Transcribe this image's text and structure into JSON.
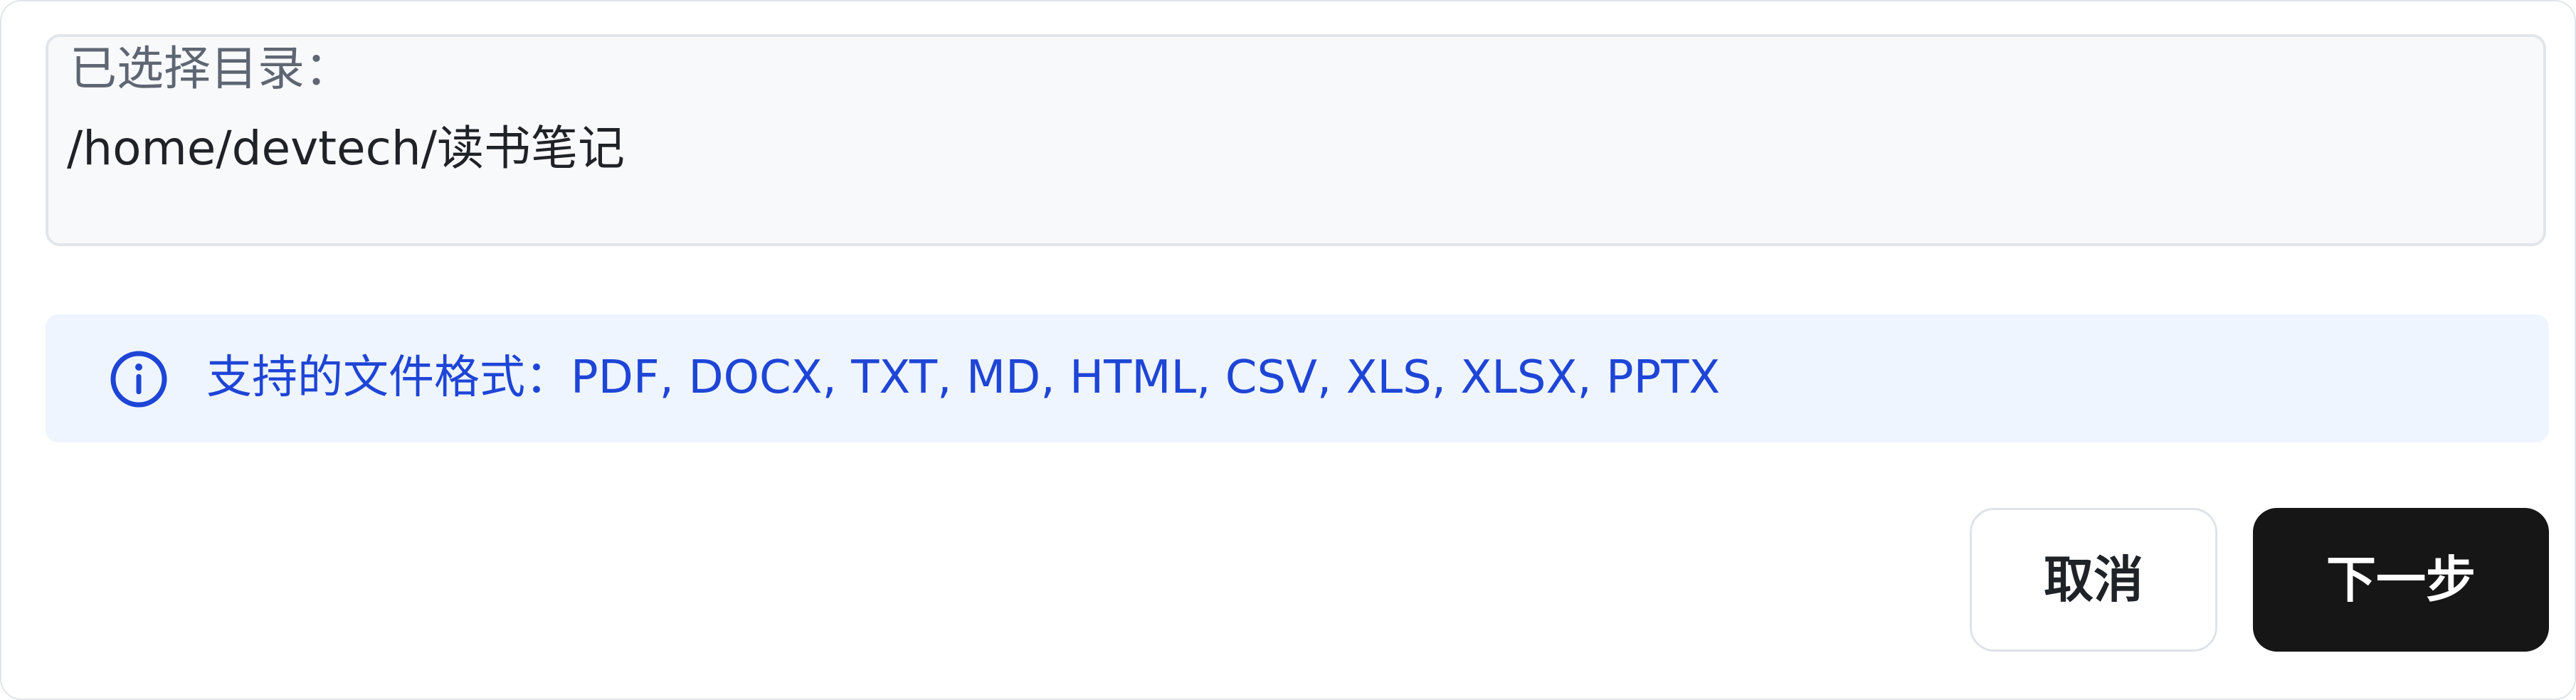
{
  "selected_dir": {
    "label": "已选择目录：",
    "path": "/home/devtech/读书笔记"
  },
  "info": {
    "icon": "info-icon",
    "text": "支持的文件格式：PDF, DOCX, TXT, MD, HTML, CSV, XLS, XLSX, PPTX",
    "color": "#1e45d6",
    "background": "#eef5ff"
  },
  "actions": {
    "cancel_label": "取消",
    "next_label": "下一步",
    "next_background": "#161616"
  }
}
